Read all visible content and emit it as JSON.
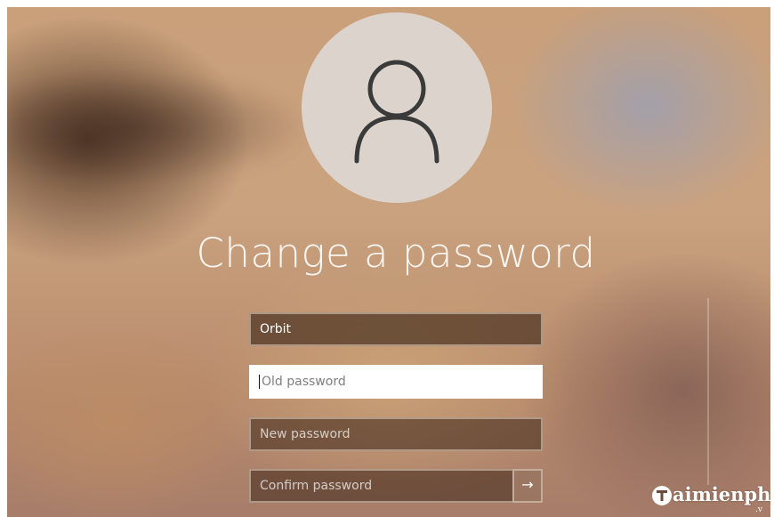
{
  "screen": {
    "title": "Change a password"
  },
  "fields": {
    "username": {
      "value": "Orbit"
    },
    "old_password": {
      "placeholder": "Old password",
      "value": ""
    },
    "new_password": {
      "placeholder": "New password",
      "value": ""
    },
    "confirm_password": {
      "placeholder": "Confirm password",
      "value": ""
    }
  },
  "submit": {
    "icon": "arrow-right-icon",
    "glyph": "→"
  },
  "avatar": {
    "icon": "user-silhouette-icon"
  },
  "watermark": {
    "text": "aimienph",
    "sub": ".v"
  },
  "colors": {
    "text_light": "#fbf6f1",
    "avatar_bg": "#dcd4cc",
    "avatar_stroke": "#3a3a3a",
    "field_dark": "#46301e",
    "field_focus": "#ffffff"
  }
}
